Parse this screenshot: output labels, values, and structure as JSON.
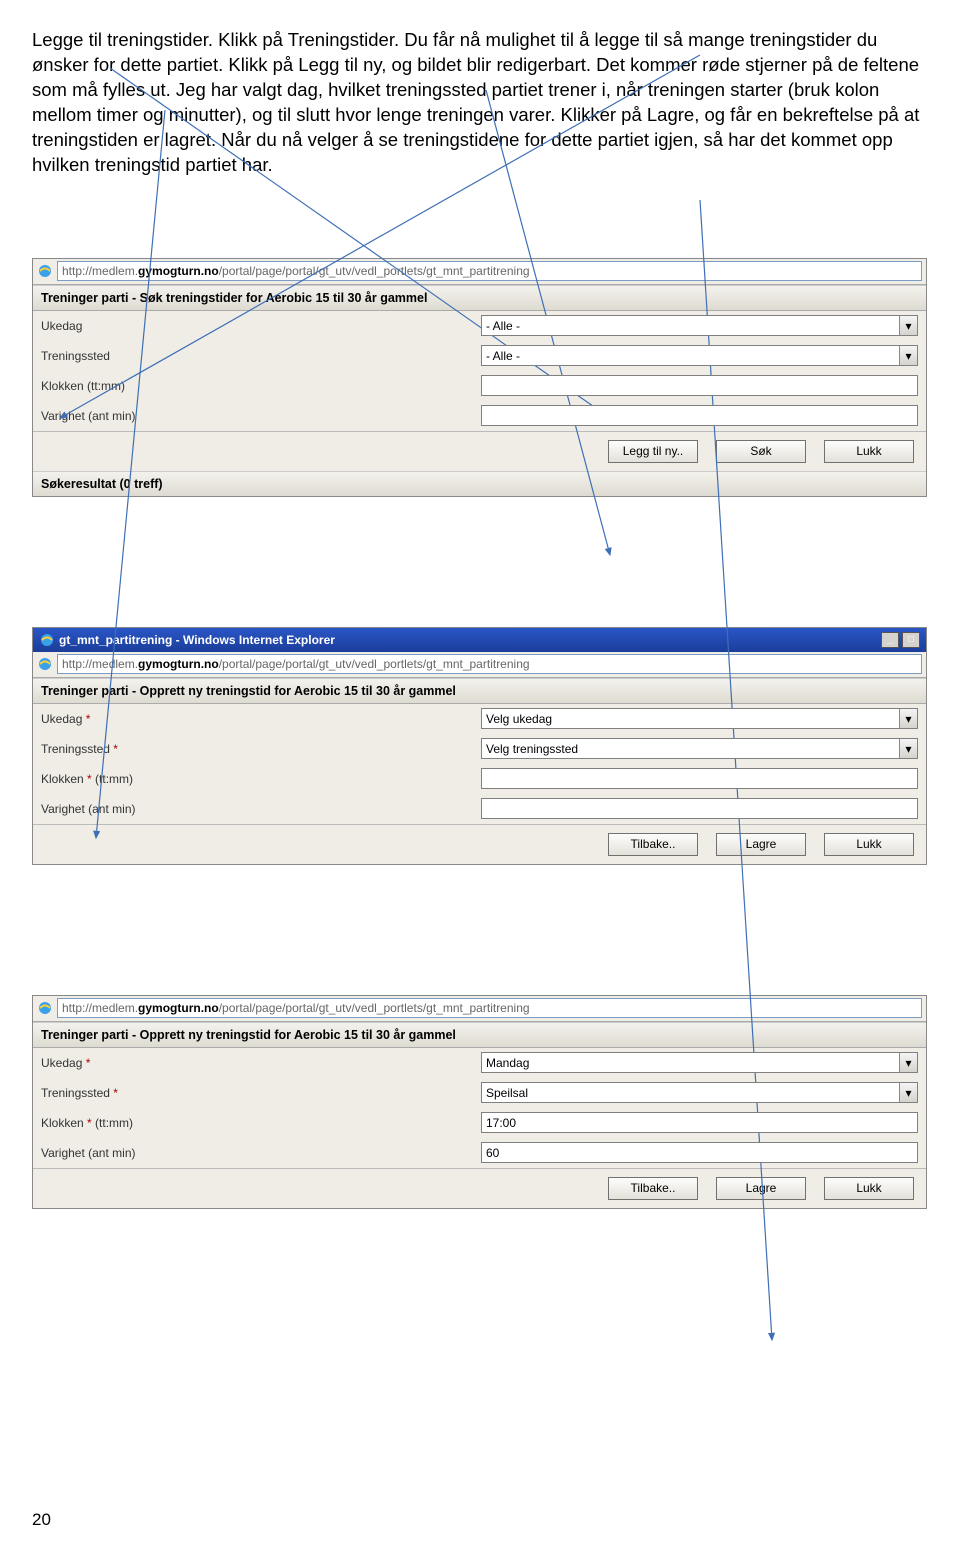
{
  "intro_text": "Legge til treningstider. Klikk på Treningstider. Du får nå mulighet til å legge til så mange treningstider du ønsker for dette partiet. Klikk på Legg til ny, og bildet blir redigerbart. Det kommer røde stjerner på de feltene som må fylles ut. Jeg har valgt dag, hvilket treningssted partiet trener i, når treningen starter (bruk kolon mellom timer og minutter), og til slutt hvor lenge treningen varer. Klikker på Lagre, og får en bekreftelse på at treningstiden er lagret. Når du nå velger å se treningstidene for dette partiet igjen, så har det kommet opp hvilken treningstid partiet har.",
  "url_prefix": "http://medlem.",
  "url_bold": "gymogturn.no",
  "url_suffix": "/portal/page/portal/gt_utv/vedl_portlets/gt_mnt_partitrening",
  "panel1": {
    "header": "Treninger parti - Søk treningstider for Aerobic 15 til 30 år gammel",
    "rows": {
      "ukedag_label": "Ukedag",
      "ukedag_value": "- Alle -",
      "sted_label": "Treningssted",
      "sted_value": "- Alle -",
      "klokken_label": "Klokken (tt:mm)",
      "klokken_value": "",
      "varighet_label": "Varighet (ant min)",
      "varighet_value": ""
    },
    "buttons": {
      "b1": "Legg til ny..",
      "b2": "Søk",
      "b3": "Lukk"
    },
    "result_header": "Søkeresultat (0 treff)"
  },
  "panel2": {
    "titlebar": "gt_mnt_partitrening - Windows Internet Explorer",
    "header": "Treninger parti - Opprett ny treningstid for Aerobic 15 til 30 år gammel",
    "rows": {
      "ukedag_label": "Ukedag ",
      "ukedag_req": "*",
      "ukedag_value": "Velg ukedag",
      "sted_label": "Treningssted ",
      "sted_req": "*",
      "sted_value": "Velg treningssted",
      "klokken_label": "Klokken ",
      "klokken_req": "*",
      "klokken_suffix": " (tt:mm)",
      "klokken_value": "",
      "varighet_label": "Varighet (ant min)",
      "varighet_value": ""
    },
    "buttons": {
      "b1": "Tilbake..",
      "b2": "Lagre",
      "b3": "Lukk"
    }
  },
  "panel3": {
    "header": "Treninger parti - Opprett ny treningstid for Aerobic 15 til 30 år gammel",
    "rows": {
      "ukedag_label": "Ukedag ",
      "ukedag_req": "*",
      "ukedag_value": "Mandag",
      "sted_label": "Treningssted ",
      "sted_req": "*",
      "sted_value": "Speilsal",
      "klokken_label": "Klokken ",
      "klokken_req": "*",
      "klokken_suffix": " (tt:mm)",
      "klokken_value": "17:00",
      "varighet_label": "Varighet (ant min)",
      "varighet_value": "60"
    },
    "buttons": {
      "b1": "Tilbake..",
      "b2": "Lagre",
      "b3": "Lukk"
    }
  },
  "page_number": "20"
}
